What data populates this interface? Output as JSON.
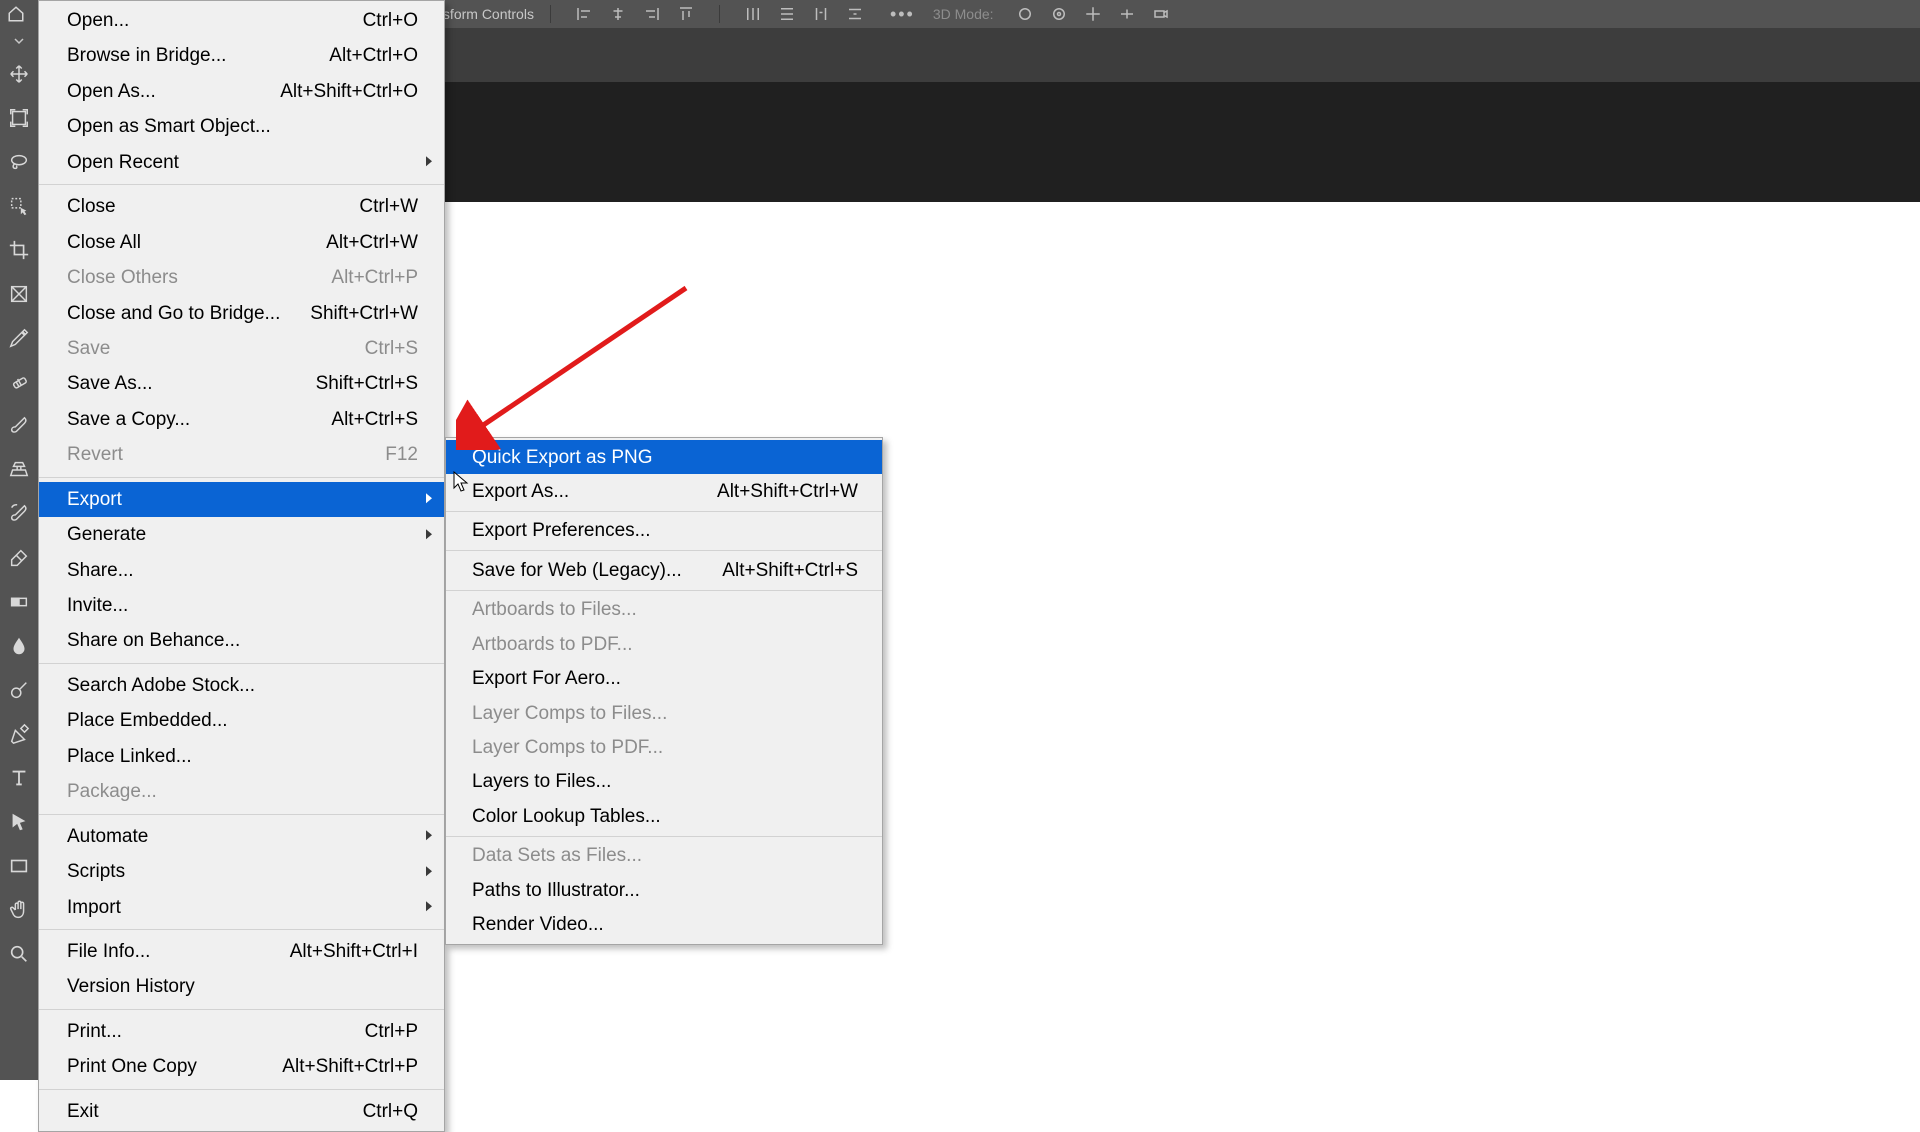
{
  "options_bar": {
    "show_transform": "Show Transform Controls",
    "mode_label": "3D Mode:"
  },
  "file_menu": {
    "groups": [
      [
        {
          "id": "open",
          "label": "Open...",
          "shortcut": "Ctrl+O"
        },
        {
          "id": "browse-bridge",
          "label": "Browse in Bridge...",
          "shortcut": "Alt+Ctrl+O"
        },
        {
          "id": "open-as",
          "label": "Open As...",
          "shortcut": "Alt+Shift+Ctrl+O"
        },
        {
          "id": "open-smart",
          "label": "Open as Smart Object..."
        },
        {
          "id": "open-recent",
          "label": "Open Recent",
          "submenu": true
        }
      ],
      [
        {
          "id": "close",
          "label": "Close",
          "shortcut": "Ctrl+W"
        },
        {
          "id": "close-all",
          "label": "Close All",
          "shortcut": "Alt+Ctrl+W"
        },
        {
          "id": "close-others",
          "label": "Close Others",
          "shortcut": "Alt+Ctrl+P",
          "disabled": true
        },
        {
          "id": "close-bridge",
          "label": "Close and Go to Bridge...",
          "shortcut": "Shift+Ctrl+W"
        },
        {
          "id": "save",
          "label": "Save",
          "shortcut": "Ctrl+S",
          "disabled": true
        },
        {
          "id": "save-as",
          "label": "Save As...",
          "shortcut": "Shift+Ctrl+S"
        },
        {
          "id": "save-copy",
          "label": "Save a Copy...",
          "shortcut": "Alt+Ctrl+S"
        },
        {
          "id": "revert",
          "label": "Revert",
          "shortcut": "F12",
          "disabled": true
        }
      ],
      [
        {
          "id": "export",
          "label": "Export",
          "submenu": true,
          "highlight": true
        },
        {
          "id": "generate",
          "label": "Generate",
          "submenu": true
        },
        {
          "id": "share",
          "label": "Share..."
        },
        {
          "id": "invite",
          "label": "Invite..."
        },
        {
          "id": "share-behance",
          "label": "Share on Behance..."
        }
      ],
      [
        {
          "id": "search-stock",
          "label": "Search Adobe Stock..."
        },
        {
          "id": "place-embedded",
          "label": "Place Embedded..."
        },
        {
          "id": "place-linked",
          "label": "Place Linked..."
        },
        {
          "id": "package",
          "label": "Package...",
          "disabled": true
        }
      ],
      [
        {
          "id": "automate",
          "label": "Automate",
          "submenu": true
        },
        {
          "id": "scripts",
          "label": "Scripts",
          "submenu": true
        },
        {
          "id": "import",
          "label": "Import",
          "submenu": true
        }
      ],
      [
        {
          "id": "file-info",
          "label": "File Info...",
          "shortcut": "Alt+Shift+Ctrl+I"
        },
        {
          "id": "version-history",
          "label": "Version History"
        }
      ],
      [
        {
          "id": "print",
          "label": "Print...",
          "shortcut": "Ctrl+P"
        },
        {
          "id": "print-one",
          "label": "Print One Copy",
          "shortcut": "Alt+Shift+Ctrl+P"
        }
      ],
      [
        {
          "id": "exit",
          "label": "Exit",
          "shortcut": "Ctrl+Q"
        }
      ]
    ]
  },
  "export_submenu": {
    "groups": [
      [
        {
          "id": "quick-export-png",
          "label": "Quick Export as PNG",
          "highlight": true
        },
        {
          "id": "export-as",
          "label": "Export As...",
          "shortcut": "Alt+Shift+Ctrl+W"
        }
      ],
      [
        {
          "id": "export-prefs",
          "label": "Export Preferences..."
        }
      ],
      [
        {
          "id": "save-for-web",
          "label": "Save for Web (Legacy)...",
          "shortcut": "Alt+Shift+Ctrl+S"
        }
      ],
      [
        {
          "id": "artboards-files",
          "label": "Artboards to Files...",
          "disabled": true
        },
        {
          "id": "artboards-pdf",
          "label": "Artboards to PDF...",
          "disabled": true
        },
        {
          "id": "export-aero",
          "label": "Export For Aero..."
        },
        {
          "id": "layer-comps-files",
          "label": "Layer Comps to Files...",
          "disabled": true
        },
        {
          "id": "layer-comps-pdf",
          "label": "Layer Comps to PDF...",
          "disabled": true
        },
        {
          "id": "layers-to-files",
          "label": "Layers to Files..."
        },
        {
          "id": "color-lookup",
          "label": "Color Lookup Tables..."
        }
      ],
      [
        {
          "id": "data-sets",
          "label": "Data Sets as Files...",
          "disabled": true
        },
        {
          "id": "paths-illustrator",
          "label": "Paths to Illustrator..."
        },
        {
          "id": "render-video",
          "label": "Render Video..."
        }
      ]
    ]
  },
  "annotation": {
    "color": "#e11b1b"
  }
}
